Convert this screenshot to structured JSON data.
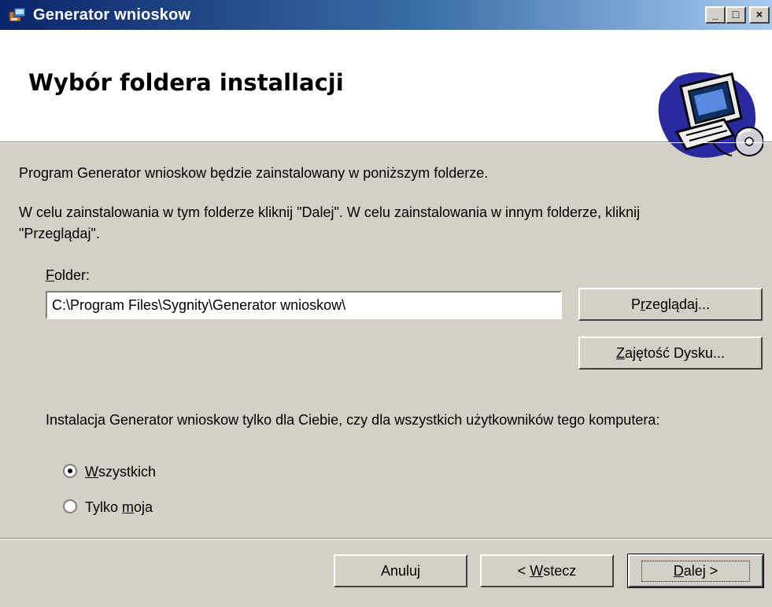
{
  "window": {
    "title": "Generator wnioskow",
    "controls": {
      "minimize": "_",
      "maximize": "□",
      "close": "×"
    }
  },
  "header": {
    "title": "Wybór foldera installacji",
    "art_icon": "computer-setup-icon"
  },
  "body": {
    "intro": "Program Generator wnioskow będzie zainstalowany w poniższym folderze.",
    "instruction_line1": "W celu zainstalowania w tym folderze kliknij \"Dalej\". W celu zainstalowania w innym folderze, kliknij",
    "instruction_line2": "\"Przeglądaj\".",
    "folder_label_accel": "F",
    "folder_label_rest": "older:",
    "folder_value": "C:\\Program Files\\Sygnity\\Generator wnioskow\\",
    "browse": {
      "pre": "P",
      "accel": "r",
      "post": "zeglądaj..."
    },
    "disk": {
      "pre": "",
      "accel": "Z",
      "post": "ajętość Dysku..."
    },
    "scope_question": "Instalacja Generator wnioskow tylko dla Ciebie, czy dla wszystkich użytkowników tego komputera:",
    "radio_all": {
      "accel": "W",
      "rest": "szystkich",
      "checked": true
    },
    "radio_me": {
      "pre": "Tylko ",
      "accel": "m",
      "post": "oja",
      "checked": false
    }
  },
  "footer": {
    "cancel_label": "Anuluj",
    "back": {
      "pre": "< ",
      "accel": "W",
      "post": "stecz"
    },
    "next": {
      "pre": "",
      "accel": "D",
      "post": "alej >"
    }
  }
}
